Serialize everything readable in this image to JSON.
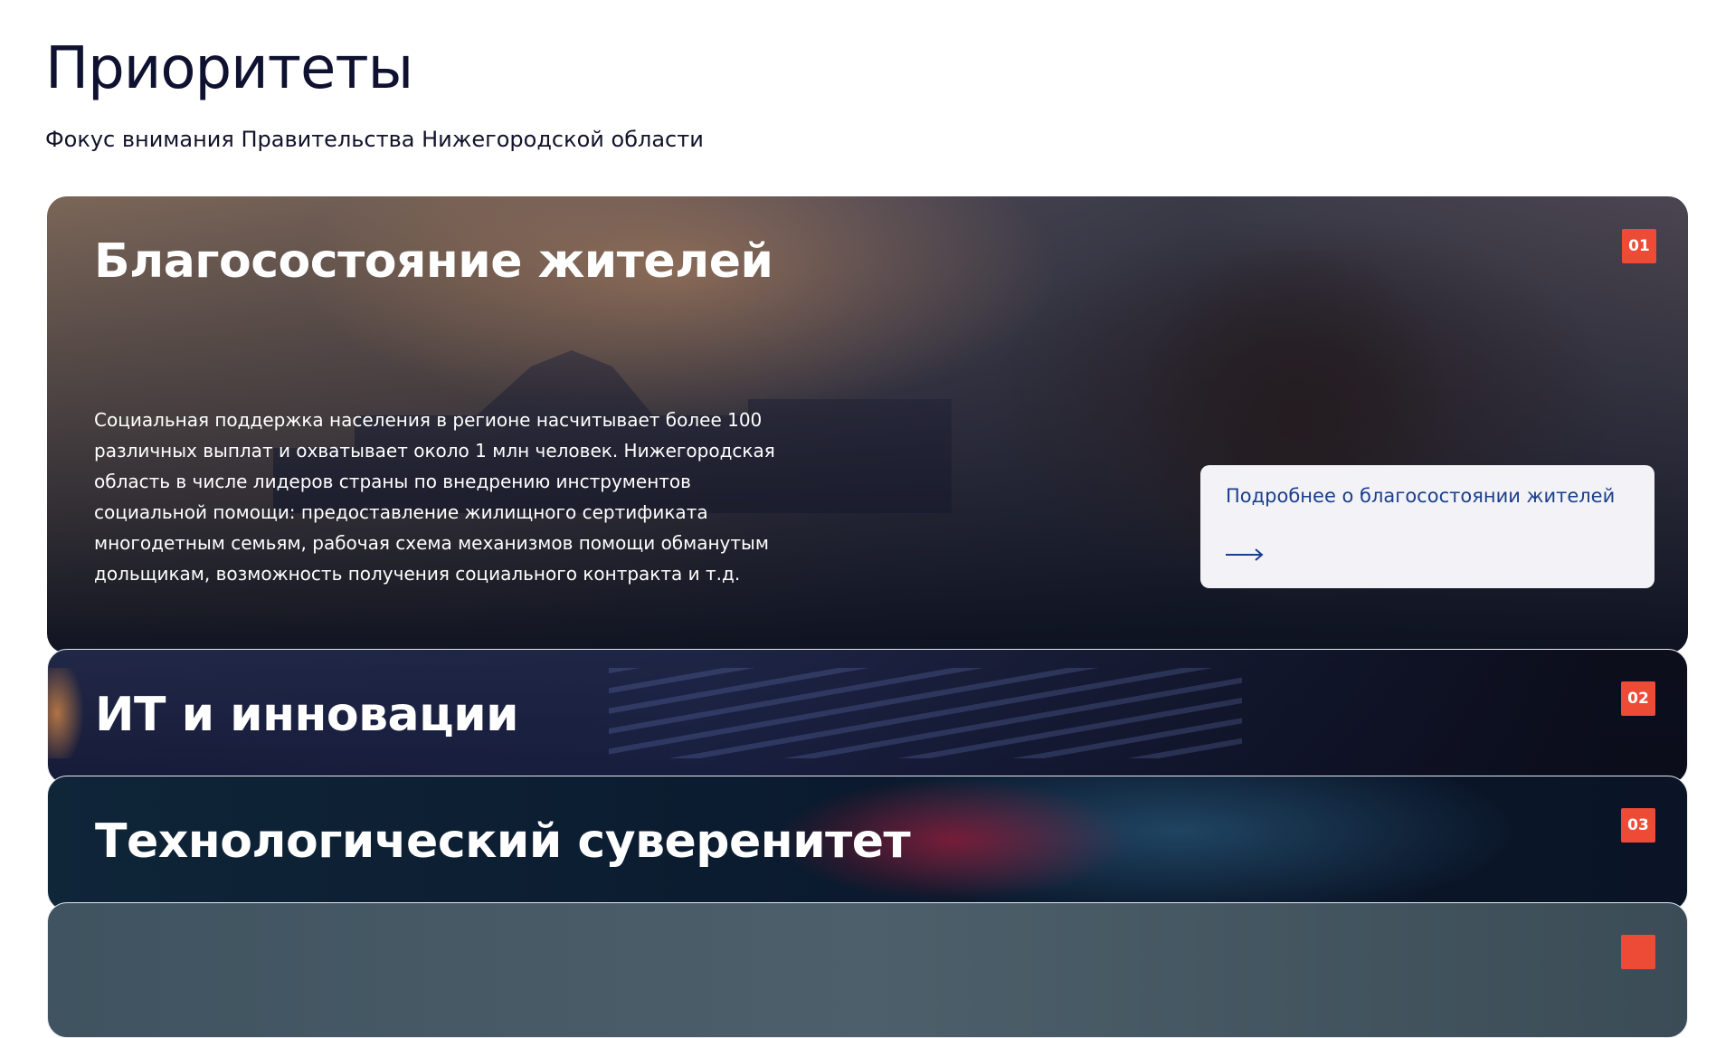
{
  "header": {
    "title": "Приоритеты",
    "subtitle": "Фокус внимания Правительства Нижегородской области"
  },
  "priorities": [
    {
      "number": "01",
      "title": "Благосостояние жителей",
      "description": "Социальная поддержка населения в регионе насчитывает более 100 различных выплат и охватывает около 1 млн человек. Нижегородская область в числе лидеров страны по внедрению инструментов социальной помощи: предоставление жилищного сертификата многодетным семьям, рабочая схема механизмов помощи обманутым дольщикам, возможность получения социального контракта и т.д.",
      "more_label": "Подробнее о благосостоянии жителей",
      "expanded": true
    },
    {
      "number": "02",
      "title": "ИТ и инновации",
      "expanded": false
    },
    {
      "number": "03",
      "title": "Технологический суверенитет",
      "expanded": false
    }
  ],
  "colors": {
    "badge": "#ee4b36",
    "link": "#1b3f8c",
    "heading": "#0f1130"
  },
  "icons": {
    "more_arrow": "arrow-right-icon"
  }
}
